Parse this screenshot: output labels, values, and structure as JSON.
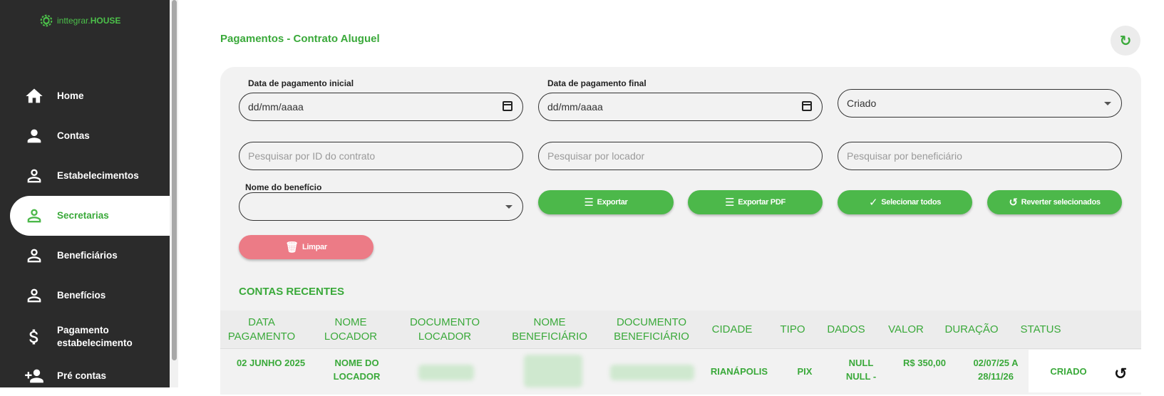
{
  "brand": {
    "name_light": "inttegrar.",
    "name_bold": "HOUSE"
  },
  "sidebar": {
    "items": [
      {
        "label": "Home",
        "icon": "home-icon"
      },
      {
        "label": "Contas",
        "icon": "person-icon"
      },
      {
        "label": "Estabelecimentos",
        "icon": "person-outline-icon"
      },
      {
        "label": "Secretarias",
        "icon": "person-outline-icon",
        "active": true
      },
      {
        "label": "Beneficiários",
        "icon": "person-outline-icon"
      },
      {
        "label": "Benefícios",
        "icon": "person-outline-icon"
      },
      {
        "label": "Pagamento estabelecimento",
        "icon": "dollar-icon"
      },
      {
        "label": "Pré contas",
        "icon": "person-add-icon"
      }
    ]
  },
  "page": {
    "title": "Pagamentos - Contrato Aluguel"
  },
  "filters": {
    "date_start_label": "Data de pagamento inicial",
    "date_start_value": "dd/mm/aaaa",
    "date_end_label": "Data de pagamento final",
    "date_end_value": "dd/mm/aaaa",
    "status_value": "Criado",
    "contract_id_placeholder": "Pesquisar por ID do contrato",
    "landlord_placeholder": "Pesquisar por locador",
    "beneficiary_placeholder": "Pesquisar por beneficiário",
    "benefit_name_label": "Nome do benefício",
    "benefit_name_value": ""
  },
  "actions": {
    "export": "Exportar",
    "export_pdf": "Exportar PDF",
    "select_all": "Selecionar todos",
    "revert_selected": "Reverter selecionados",
    "clear": "Limpar"
  },
  "table": {
    "section_title": "CONTAS RECENTES",
    "columns": [
      "DATA PAGAMENTO",
      "NOME LOCADOR",
      "DOCUMENTO LOCADOR",
      "NOME BENEFICIÁRIO",
      "DOCUMENTO BENEFICIÁRIO",
      "CIDADE",
      "TIPO",
      "DADOS",
      "VALOR",
      "DURAÇÃO",
      "STATUS"
    ],
    "rows": [
      {
        "data_pagamento": "02 JUNHO 2025",
        "nome_locador": "NOME DO LOCADOR",
        "cidade": "RIANÁPOLIS",
        "tipo": "PIX",
        "dados": "NULL NULL -",
        "valor": "R$ 350,00",
        "duracao": "02/07/25 A 28/11/26",
        "status": "CRIADO"
      }
    ]
  },
  "colors": {
    "accent": "#4cb84a",
    "accent_text": "#3aa93a",
    "danger": "#ec7b86",
    "sidebar": "#2b2b2b"
  }
}
